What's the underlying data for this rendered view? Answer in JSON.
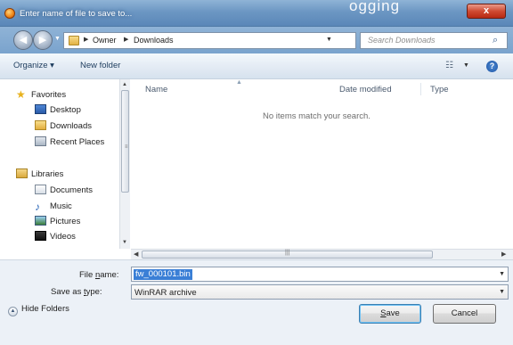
{
  "window": {
    "title": "Enter name of file to save to...",
    "background_title": "ogging",
    "close_label": "x"
  },
  "address": {
    "crumbs": [
      "Owner",
      "Downloads"
    ],
    "search_placeholder": "Search Downloads"
  },
  "toolbar": {
    "organize_label": "Organize ▾",
    "new_folder_label": "New folder"
  },
  "nav": {
    "favorites": {
      "label": "Favorites",
      "items": [
        "Desktop",
        "Downloads",
        "Recent Places"
      ]
    },
    "libraries": {
      "label": "Libraries",
      "items": [
        "Documents",
        "Music",
        "Pictures",
        "Videos"
      ]
    }
  },
  "filelist": {
    "columns": [
      "Name",
      "Date modified",
      "Type"
    ],
    "empty_message": "No items match your search."
  },
  "form": {
    "file_name_label_pre": "File ",
    "file_name_label_u": "n",
    "file_name_label_post": "ame:",
    "file_name_value": "fw_000101.bin",
    "save_type_label_pre": "Save as ",
    "save_type_label_u": "t",
    "save_type_label_post": "ype:",
    "save_type_value": "WinRAR archive"
  },
  "buttons": {
    "hide_folders": "Hide Folders",
    "save_u": "S",
    "save_rest": "ave",
    "cancel": "Cancel"
  },
  "colors": {
    "accent": "#3a7fd6",
    "titlebar": "#6c97c3",
    "close": "#cf4b33"
  }
}
